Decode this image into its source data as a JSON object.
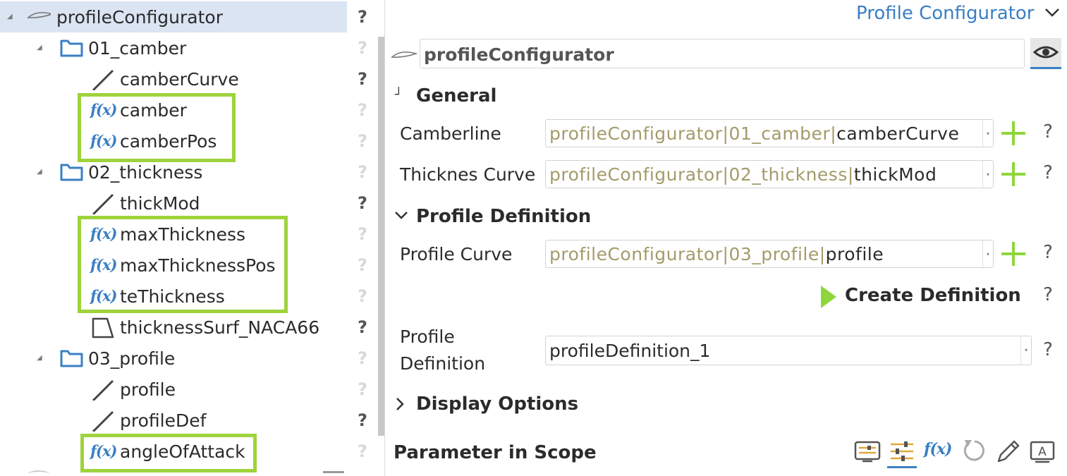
{
  "tree": {
    "root": {
      "label": "profileConfigurator",
      "help": "?"
    },
    "items": [
      {
        "label": "01_camber",
        "help": "?"
      },
      {
        "label": "camberCurve",
        "help": "?"
      },
      {
        "label": "camber",
        "help": "?",
        "fx": "f(x)"
      },
      {
        "label": "camberPos",
        "help": "?",
        "fx": "f(x)"
      },
      {
        "label": "02_thickness",
        "help": "?"
      },
      {
        "label": "thickMod",
        "help": "?"
      },
      {
        "label": "maxThickness",
        "help": "?",
        "fx": "f(x)"
      },
      {
        "label": "maxThicknessPos",
        "help": "?",
        "fx": "f(x)"
      },
      {
        "label": "teThickness",
        "help": "?",
        "fx": "f(x)"
      },
      {
        "label": "thicknessSurf_NACA66",
        "help": "?"
      },
      {
        "label": "03_profile",
        "help": "?"
      },
      {
        "label": "profile",
        "help": "?"
      },
      {
        "label": "profileDef",
        "help": "?"
      },
      {
        "label": "angleOfAttack",
        "help": "?",
        "fx": "f(x)"
      }
    ],
    "highlight_color": "#9fd33c"
  },
  "panel": {
    "header": {
      "title": "Profile Configurator"
    },
    "name_field": {
      "value": "profileConfigurator"
    },
    "general": {
      "title": "General",
      "camberline": {
        "label": "Camberline",
        "path_prefix": "profileConfigurator",
        "path_mid": "01_camber",
        "value": "camberCurve",
        "help": "?"
      },
      "thickness": {
        "label": "Thicknes Curve",
        "path_prefix": "profileConfigurator",
        "path_mid": "02_thickness",
        "value": "thickMod",
        "help": "?"
      }
    },
    "profile_definition": {
      "title": "Profile Definition",
      "profile_curve": {
        "label": "Profile Curve",
        "path_prefix": "profileConfigurator",
        "path_mid": "03_profile",
        "value": "profile",
        "help": "?"
      },
      "create_button": {
        "label": "Create Definition",
        "help": "?"
      },
      "definition": {
        "label_line1": "Profile",
        "label_line2": "Definition",
        "value": "profileDefinition_1",
        "help": "?"
      }
    },
    "display_options": {
      "title": "Display Options"
    },
    "parameter_scope": {
      "title": "Parameter in Scope",
      "fx": "f(x)"
    },
    "accent_color": "#3a7fc4",
    "add_color": "#8fd63c"
  }
}
